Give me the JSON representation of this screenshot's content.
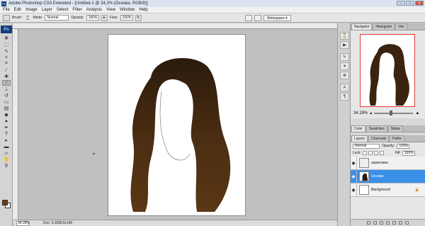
{
  "window": {
    "title": "Adobe Photoshop CS3 Extended - [Untitled-1 @ 34,3% (Основа, RGB/8)]"
  },
  "menu": [
    "File",
    "Edit",
    "Image",
    "Layer",
    "Select",
    "Filter",
    "Analysis",
    "View",
    "Window",
    "Help"
  ],
  "options": {
    "brush_label": "Brush:",
    "brush_size": "41",
    "mode_label": "Mode:",
    "mode_value": "Normal",
    "opacity_label": "Opacity:",
    "opacity_value": "100%",
    "flow_label": "Flow:",
    "flow_value": "100%",
    "workspace_label": "Workspace"
  },
  "status": {
    "zoom": "34.28%",
    "doc": "Doc: 6.32M/16.6M"
  },
  "navigator": {
    "tabs": [
      "Navigator",
      "Histogram",
      "Info"
    ],
    "zoom": "34.28%"
  },
  "color_panel": {
    "tabs": [
      "Color",
      "Swatches",
      "Styles"
    ]
  },
  "layers_panel": {
    "tabs": [
      "Layers",
      "Channels",
      "Paths"
    ],
    "blend_mode": "Normal",
    "opacity_label": "Opacity:",
    "opacity_value": "100%",
    "lock_label": "Lock:",
    "fill_label": "Fill:",
    "fill_value": "100%",
    "layers": [
      {
        "name": "зарисовка",
        "selected": false
      },
      {
        "name": "Основа",
        "selected": true
      },
      {
        "name": "Background",
        "selected": false
      }
    ]
  },
  "colors": {
    "foreground": "#6a3a14",
    "background": "#ffffff",
    "accent": "#3a8fe8"
  }
}
